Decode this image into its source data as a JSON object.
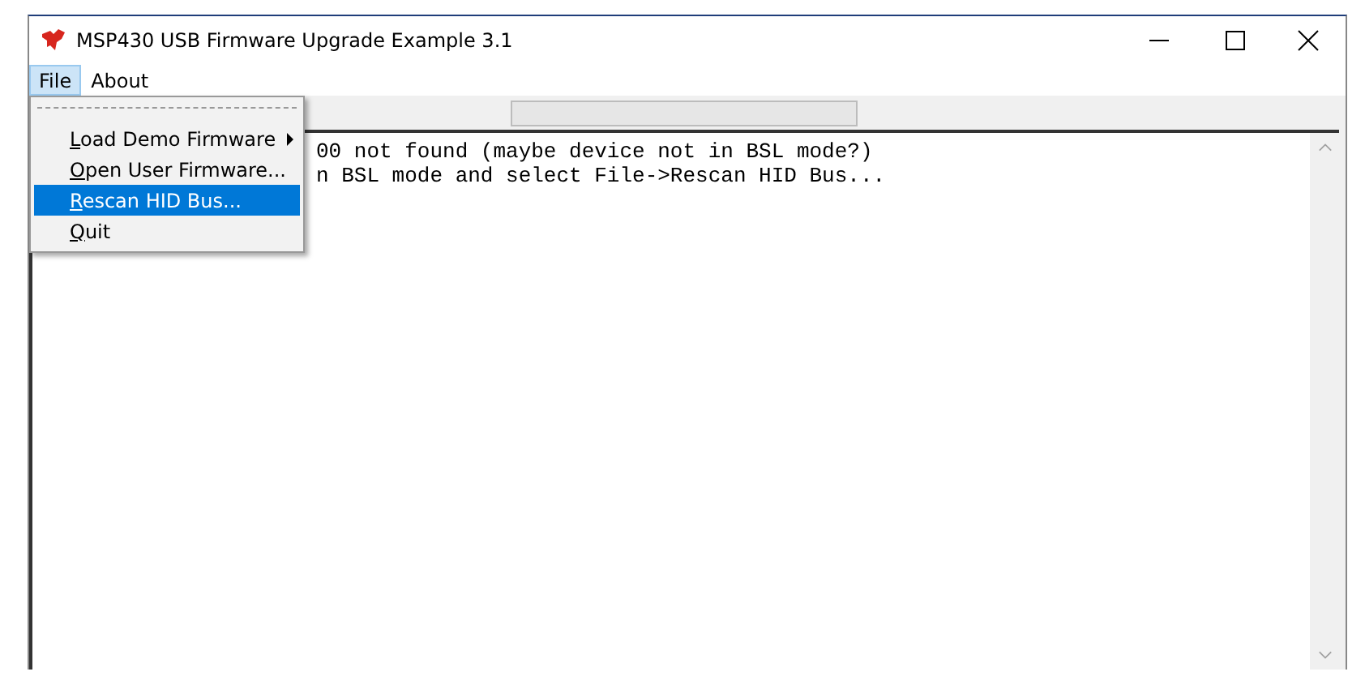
{
  "window": {
    "title": "MSP430 USB Firmware Upgrade Example 3.1"
  },
  "menu_bar": [
    {
      "label": "File",
      "selected": true
    },
    {
      "label": "About",
      "selected": false
    }
  ],
  "file_menu": {
    "items": [
      {
        "label": "Load Demo Firmware",
        "selected": false,
        "submenu": true
      },
      {
        "label": "Open User Firmware...",
        "selected": false,
        "submenu": false
      },
      {
        "label": "Rescan HID Bus...",
        "selected": true,
        "submenu": false
      },
      {
        "label": "Quit",
        "selected": false,
        "submenu": false
      }
    ]
  },
  "progress": {
    "level": 0
  },
  "log": {
    "lines": [
      "00 not found (maybe device not in BSL mode?)",
      "n BSL mode and select File->Rescan HID Bus..."
    ]
  }
}
